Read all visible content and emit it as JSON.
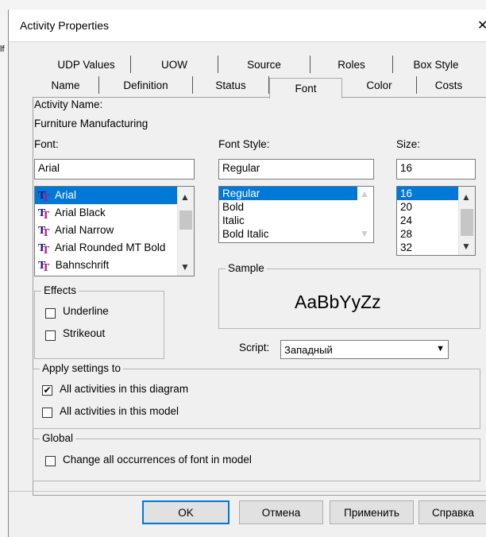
{
  "window": {
    "title": "Activity Properties",
    "close_glyph": "✕",
    "left_stub": "lf"
  },
  "tabs_row1": [
    "UDP Values",
    "UOW",
    "Source",
    "Roles",
    "Box Style"
  ],
  "tabs_row2": [
    "Name",
    "Definition",
    "Status",
    "Font",
    "Color",
    "Costs"
  ],
  "active_tab": "Font",
  "activity": {
    "name_label": "Activity Name:",
    "name_value": "Furniture Manufacturing"
  },
  "font": {
    "label": "Font:",
    "value": "Arial",
    "items": [
      "Arial",
      "Arial Black",
      "Arial Narrow",
      "Arial Rounded MT Bold",
      "Bahnschrift"
    ],
    "selected": "Arial",
    "item_icon": "truetype-font-icon"
  },
  "font_style": {
    "label": "Font Style:",
    "value": "Regular",
    "items": [
      "Regular",
      "Bold",
      "Italic",
      "Bold Italic"
    ],
    "selected": "Regular"
  },
  "size": {
    "label": "Size:",
    "value": "16",
    "items": [
      "16",
      "20",
      "24",
      "28",
      "32"
    ],
    "selected": "16"
  },
  "effects": {
    "label": "Effects",
    "underline": "Underline",
    "underline_checked": false,
    "strikeout": "Strikeout",
    "strikeout_checked": false
  },
  "sample": {
    "label": "Sample",
    "text": "AaBbYyZz"
  },
  "script": {
    "label": "Script:",
    "value": "Западный"
  },
  "apply": {
    "label": "Apply settings to",
    "diagram": "All activities in this diagram",
    "diagram_checked": true,
    "model": "All activities in this model",
    "model_checked": false
  },
  "global": {
    "label": "Global",
    "change_all": "Change all occurrences of font in model",
    "change_all_checked": false
  },
  "buttons": {
    "ok": "OK",
    "cancel": "Отмена",
    "apply": "Применить",
    "help": "Справка"
  },
  "colors": {
    "selection": "#0078d7",
    "dialog_bg": "#f0f0f0"
  }
}
